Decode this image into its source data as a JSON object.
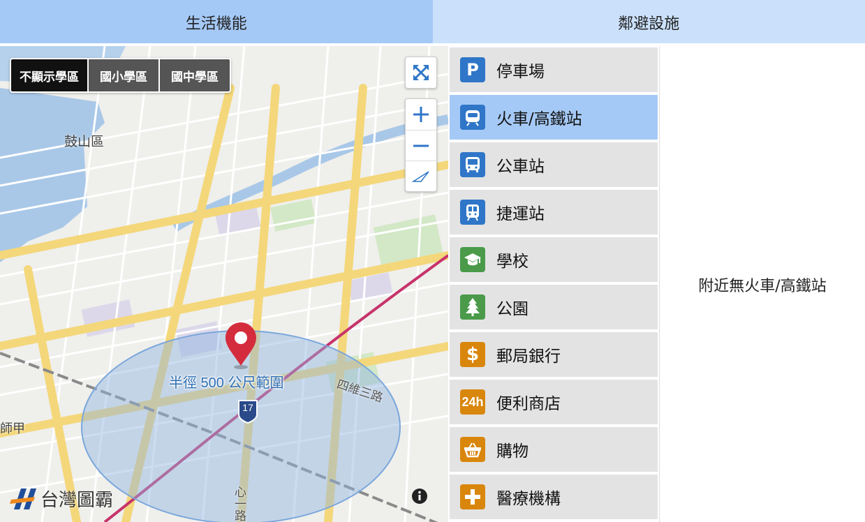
{
  "tabs": [
    {
      "label": "生活機能",
      "active": true
    },
    {
      "label": "鄰避設施",
      "active": false
    }
  ],
  "map": {
    "school_filters": [
      "不顯示學區",
      "國小學區",
      "國中學區"
    ],
    "selected_filter": "不顯示學區",
    "radius_label": "半徑 500 公尺範圍",
    "route_shield": "17",
    "district_labels": [
      "鼓山區",
      "師甲"
    ],
    "road_labels": [
      "四維三路",
      "心一路"
    ],
    "logo_text": "台灣圖霸",
    "controls": [
      "fullscreen-icon",
      "zoom-in-icon",
      "zoom-out-icon",
      "compass-icon"
    ]
  },
  "categories": [
    {
      "label": "停車場",
      "icon": "parking-icon",
      "glyph": "P",
      "color": "#2f76c8",
      "active": false
    },
    {
      "label": "火車/高鐵站",
      "icon": "train-icon",
      "glyph": "",
      "color": "#2f76c8",
      "active": true
    },
    {
      "label": "公車站",
      "icon": "bus-icon",
      "glyph": "",
      "color": "#2f76c8",
      "active": false
    },
    {
      "label": "捷運站",
      "icon": "metro-icon",
      "glyph": "",
      "color": "#2f76c8",
      "active": false
    },
    {
      "label": "學校",
      "icon": "school-icon",
      "glyph": "",
      "color": "#4a9a4a",
      "active": false
    },
    {
      "label": "公園",
      "icon": "park-icon",
      "glyph": "",
      "color": "#4a9a4a",
      "active": false
    },
    {
      "label": "郵局銀行",
      "icon": "bank-icon",
      "glyph": "$",
      "color": "#d9860c",
      "active": false
    },
    {
      "label": "便利商店",
      "icon": "convenience-store-icon",
      "glyph": "24h",
      "color": "#d9860c",
      "active": false
    },
    {
      "label": "購物",
      "icon": "shopping-basket-icon",
      "glyph": "",
      "color": "#d9860c",
      "active": false
    },
    {
      "label": "醫療機構",
      "icon": "medical-icon",
      "glyph": "+",
      "color": "#d9860c",
      "active": false
    }
  ],
  "results": {
    "empty_message": "附近無火車/高鐵站"
  },
  "colors": {
    "tab_active": "#a5c9f6",
    "tab_inactive": "#cbe1fb",
    "item_active": "#a5c9f6",
    "item_inactive": "#e3e3e3",
    "radius_fill": "#8fb4e3",
    "marker": "#d42c3c"
  }
}
